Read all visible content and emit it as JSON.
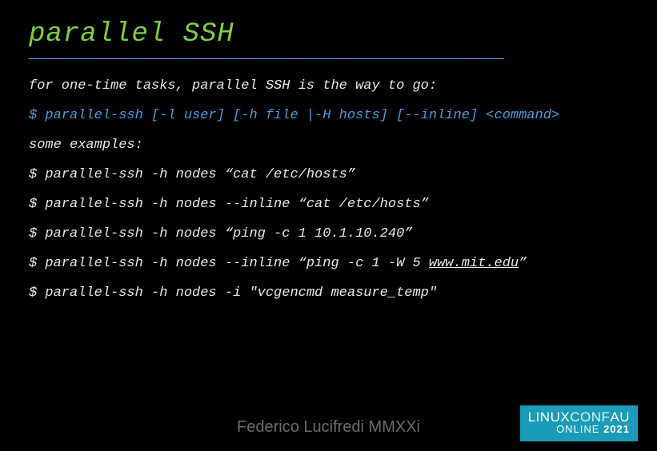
{
  "title": "parallel SSH",
  "divider": "———————————————————————————————————————————————————————",
  "intro": "for one-time tasks, parallel SSH is the way to go:",
  "syntax": "$ parallel-ssh [-l user] [-h file |-H hosts] [--inline] <command>",
  "examples_label": "some examples:",
  "examples": [
    "$ parallel-ssh -h nodes “cat /etc/hosts”",
    "$ parallel-ssh -h nodes --inline “cat /etc/hosts”",
    "$ parallel-ssh -h nodes “ping -c 1 10.1.10.240”"
  ],
  "example_with_link": {
    "prefix": "$ parallel-ssh -h nodes --inline “ping -c 1 -W 5 ",
    "link": "www.mit.edu",
    "suffix": "”"
  },
  "last_example": "$ parallel-ssh -h nodes -i \"vcgencmd measure_temp\"",
  "author": "Federico Lucifredi MMXXi",
  "badge": {
    "line1a": "LINUX",
    "line1b": "CONF",
    "line1c": "AU",
    "line2a": "ONLINE ",
    "line2b": "2021"
  }
}
